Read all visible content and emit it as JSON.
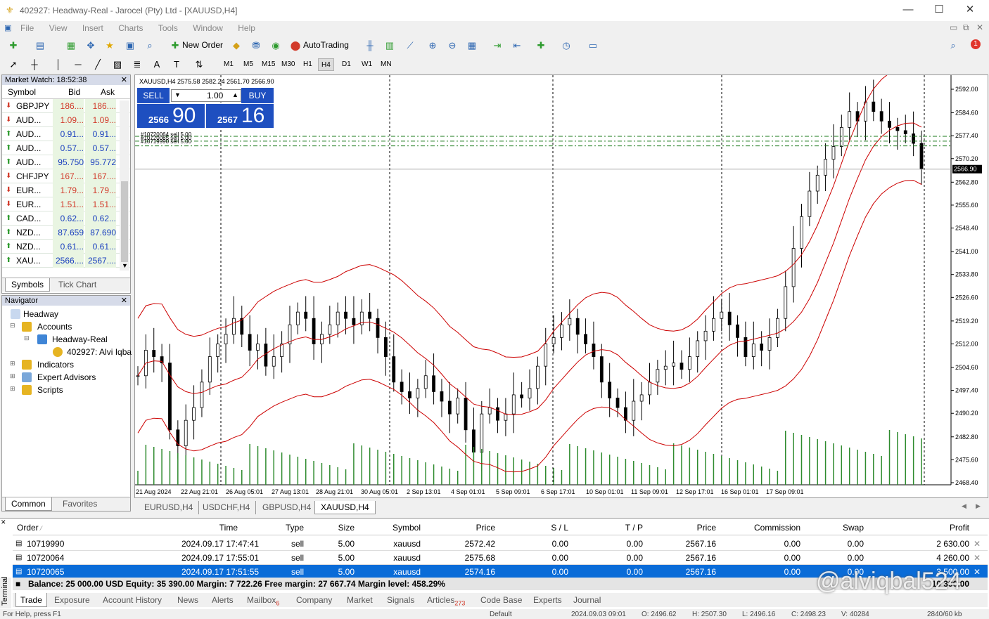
{
  "window": {
    "title": "402927: Headway-Real - Jarocel (Pty) Ltd - [XAUUSD,H4]"
  },
  "menu": [
    "File",
    "View",
    "Insert",
    "Charts",
    "Tools",
    "Window",
    "Help"
  ],
  "toolbar": {
    "new_order": "New Order",
    "autotrading": "AutoTrading",
    "notification_count": "1"
  },
  "timeframes": [
    "M1",
    "M5",
    "M15",
    "M30",
    "H1",
    "H4",
    "D1",
    "W1",
    "MN"
  ],
  "active_timeframe": "H4",
  "market_watch": {
    "title": "Market Watch: 18:52:38",
    "cols": {
      "symbol": "Symbol",
      "bid": "Bid",
      "ask": "Ask"
    },
    "rows": [
      {
        "symbol": "GBPJPY",
        "bid": "186....",
        "ask": "186....",
        "dir": "down"
      },
      {
        "symbol": "AUD...",
        "bid": "1.09...",
        "ask": "1.09...",
        "dir": "down"
      },
      {
        "symbol": "AUD...",
        "bid": "0.91...",
        "ask": "0.91...",
        "dir": "up"
      },
      {
        "symbol": "AUD...",
        "bid": "0.57...",
        "ask": "0.57...",
        "dir": "up"
      },
      {
        "symbol": "AUD...",
        "bid": "95.750",
        "ask": "95.772",
        "dir": "up"
      },
      {
        "symbol": "CHFJPY",
        "bid": "167....",
        "ask": "167....",
        "dir": "down"
      },
      {
        "symbol": "EUR...",
        "bid": "1.79...",
        "ask": "1.79...",
        "dir": "down"
      },
      {
        "symbol": "EUR...",
        "bid": "1.51...",
        "ask": "1.51...",
        "dir": "down"
      },
      {
        "symbol": "CAD...",
        "bid": "0.62...",
        "ask": "0.62...",
        "dir": "up"
      },
      {
        "symbol": "NZD...",
        "bid": "87.659",
        "ask": "87.690",
        "dir": "up"
      },
      {
        "symbol": "NZD...",
        "bid": "0.61...",
        "ask": "0.61...",
        "dir": "up"
      },
      {
        "symbol": "XAU...",
        "bid": "2566....",
        "ask": "2567....",
        "dir": "up"
      }
    ],
    "tabs": [
      "Symbols",
      "Tick Chart"
    ]
  },
  "navigator": {
    "title": "Navigator",
    "items": [
      "Headway",
      "Accounts",
      "Headway-Real",
      "402927: Alvi Iqba",
      "Indicators",
      "Expert Advisors",
      "Scripts"
    ],
    "tabs": [
      "Common",
      "Favorites"
    ]
  },
  "chart": {
    "header": "XAUUSD,H4  2575.58 2582.24 2561.70 2566.90",
    "sell_label": "SELL",
    "buy_label": "BUY",
    "lot": "1.00",
    "sell_price_small": "2566",
    "sell_price_big": "90",
    "buy_price_small": "2567",
    "buy_price_big": "16",
    "order_lines": [
      "#10720064 sell 5.00",
      "#10720065 sell 5.00",
      "#10719990 sell 5.00"
    ],
    "current_price": "2566.90",
    "price_axis": [
      "2592.00",
      "2584.60",
      "2577.40",
      "2570.20",
      "2562.80",
      "2555.60",
      "2548.40",
      "2541.00",
      "2533.80",
      "2526.60",
      "2519.20",
      "2512.00",
      "2504.60",
      "2497.40",
      "2490.20",
      "2482.80",
      "2475.60",
      "2468.40"
    ],
    "time_axis": [
      "21 Aug 2024",
      "22 Aug 21:01",
      "26 Aug 05:01",
      "27 Aug 13:01",
      "28 Aug 21:01",
      "30 Aug 05:01",
      "2 Sep 13:01",
      "4 Sep 01:01",
      "5 Sep 09:01",
      "6 Sep 17:01",
      "10 Sep 01:01",
      "11 Sep 09:01",
      "12 Sep 17:01",
      "16 Sep 01:01",
      "17 Sep 09:01"
    ],
    "colors": {
      "up": "#000000",
      "down": "#000000",
      "bollinger": "#cc0000",
      "volume": "#2e8b2e",
      "order_line": "#1a7a1a",
      "trade_panel": "#1e4fc0"
    }
  },
  "chart_tabs": [
    "EURUSD,H4",
    "USDCHF,H4",
    "GBPUSD,H4",
    "XAUUSD,H4"
  ],
  "terminal": {
    "columns": [
      "Order",
      "Time",
      "Type",
      "Size",
      "Symbol",
      "Price",
      "S / L",
      "T / P",
      "Price",
      "Commission",
      "Swap",
      "Profit"
    ],
    "rows": [
      {
        "order": "10719990",
        "time": "2024.09.17 17:47:41",
        "type": "sell",
        "size": "5.00",
        "symbol": "xauusd",
        "price": "2572.42",
        "sl": "0.00",
        "tp": "0.00",
        "cur": "2567.16",
        "commission": "0.00",
        "swap": "0.00",
        "profit": "2 630.00"
      },
      {
        "order": "10720064",
        "time": "2024.09.17 17:55:01",
        "type": "sell",
        "size": "5.00",
        "symbol": "xauusd",
        "price": "2575.68",
        "sl": "0.00",
        "tp": "0.00",
        "cur": "2567.16",
        "commission": "0.00",
        "swap": "0.00",
        "profit": "4 260.00"
      },
      {
        "order": "10720065",
        "time": "2024.09.17 17:51:55",
        "type": "sell",
        "size": "5.00",
        "symbol": "xauusd",
        "price": "2574.16",
        "sl": "0.00",
        "tp": "0.00",
        "cur": "2567.16",
        "commission": "0.00",
        "swap": "0.00",
        "profit": "3 500.00"
      }
    ],
    "balance": "Balance: 25 000.00 USD  Equity: 35 390.00  Margin: 7 722.26  Free margin: 27 667.74  Margin level: 458.29%",
    "total": "10 390.00",
    "side_label": "Terminal",
    "tabs": [
      "Trade",
      "Exposure",
      "Account History",
      "News",
      "Alerts",
      "Mailbox",
      "Company",
      "Market",
      "Signals",
      "Articles",
      "Code Base",
      "Experts",
      "Journal"
    ],
    "mailbox_badge": "6",
    "articles_badge": "273"
  },
  "status": {
    "help": "For Help, press F1",
    "profile": "Default",
    "date": "2024.09.03 09:01",
    "open": "O: 2496.62",
    "high": "H: 2507.30",
    "low": "L: 2496.16",
    "close": "C: 2498.23",
    "volume": "V: 40284",
    "net": "2840/60 kb"
  },
  "watermark": "@alviqbal524"
}
